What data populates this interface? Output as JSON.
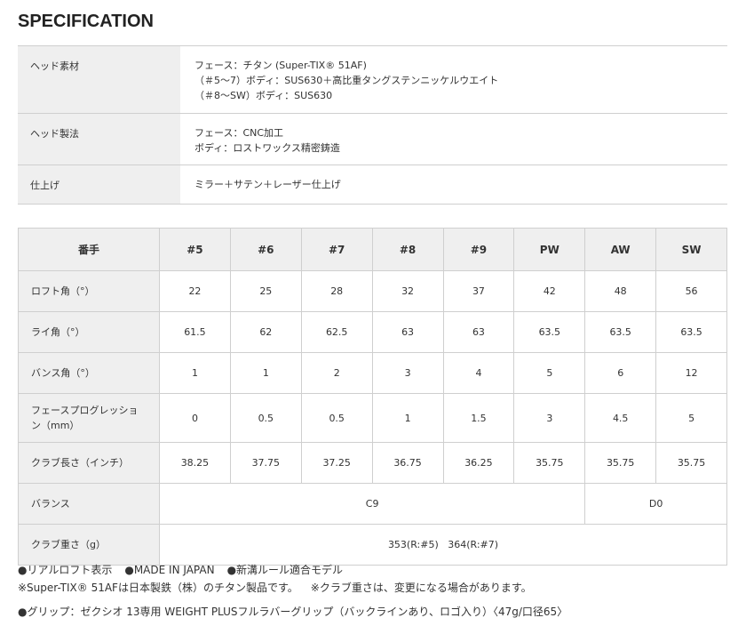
{
  "title": "SPECIFICATION",
  "spec_rows": [
    {
      "label": "ヘッド素材",
      "lines": [
        "フェース：チタン (Super-TIX® 51AF)",
        "（＃5〜7）ボディ：SUS630＋高比重タングステンニッケルウエイト",
        "（＃8〜SW）ボディ：SUS630"
      ]
    },
    {
      "label": "ヘッド製法",
      "lines": [
        "フェース：CNC加工",
        "ボディ：ロストワックス精密鋳造"
      ]
    },
    {
      "label": "仕上げ",
      "lines": [
        "ミラー＋サテン＋レーザー仕上げ"
      ]
    }
  ],
  "data_table": {
    "header": [
      "番手",
      "#5",
      "#6",
      "#7",
      "#8",
      "#9",
      "PW",
      "AW",
      "SW"
    ],
    "rows": [
      {
        "label": "ロフト角（°）",
        "values": [
          "22",
          "25",
          "28",
          "32",
          "37",
          "42",
          "48",
          "56"
        ]
      },
      {
        "label": "ライ角（°）",
        "values": [
          "61.5",
          "62",
          "62.5",
          "63",
          "63",
          "63.5",
          "63.5",
          "63.5"
        ]
      },
      {
        "label": "バンス角（°）",
        "values": [
          "1",
          "1",
          "2",
          "3",
          "4",
          "5",
          "6",
          "12"
        ]
      },
      {
        "label_lines": [
          "フェースプログレッショ",
          "ン（mm）"
        ],
        "values": [
          "0",
          "0.5",
          "0.5",
          "1",
          "1.5",
          "3",
          "4.5",
          "5"
        ]
      },
      {
        "label": "クラブ長さ（インチ）",
        "values": [
          "38.25",
          "37.75",
          "37.25",
          "36.75",
          "36.25",
          "35.75",
          "35.75",
          "35.75"
        ]
      }
    ],
    "balance": {
      "label": "バランス",
      "value_a": "C9",
      "value_b": "D0"
    },
    "weight": {
      "label": "クラブ重さ（g）",
      "value": "353(R:#5)   364(R:#7)"
    }
  },
  "notes": {
    "line1": [
      "●リアルロフト表示",
      "●MADE IN JAPAN",
      "●新溝ルール適合モデル"
    ],
    "line2": [
      "※Super-TIX® 51AFは日本製鉄（株）のチタン製品です。",
      "※クラブ重さは、変更になる場合があります。"
    ],
    "line3": "●グリップ：ゼクシオ 13専用 WEIGHT PLUSフルラバーグリップ（バックラインあり、ロゴ入り）〈47g/口径65〉"
  }
}
